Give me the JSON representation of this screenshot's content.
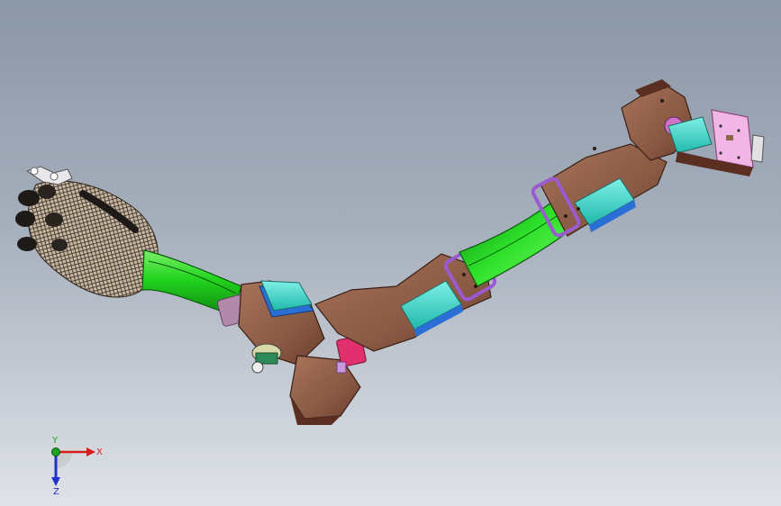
{
  "triad": {
    "x_label": "X",
    "y_label": "Y",
    "z_label": "Z",
    "x_color": "#d61c1c",
    "y_color": "#1fa31f",
    "z_color": "#2232c8"
  },
  "colors": {
    "background_top": "#8c97a7",
    "background_bottom": "#dfe3e8",
    "bracket_brown": "#8a5a44",
    "bracket_dark": "#5a2f22",
    "link_green": "#22d41e",
    "servo_cyan": "#35d6c8",
    "servo_blue": "#2a6fd6",
    "joint_purple": "#9a5ad0",
    "motor_magenta": "#e0306e",
    "plate_pink": "#f2b6e6",
    "glove_mesh": "#7a6a58"
  },
  "components": {
    "hand": "glove-mesh-icon",
    "forearm": "green-link-icon",
    "upper_arm": "green-link-icon",
    "servos": "servo-icon",
    "base_plate": "mount-plate-icon"
  }
}
